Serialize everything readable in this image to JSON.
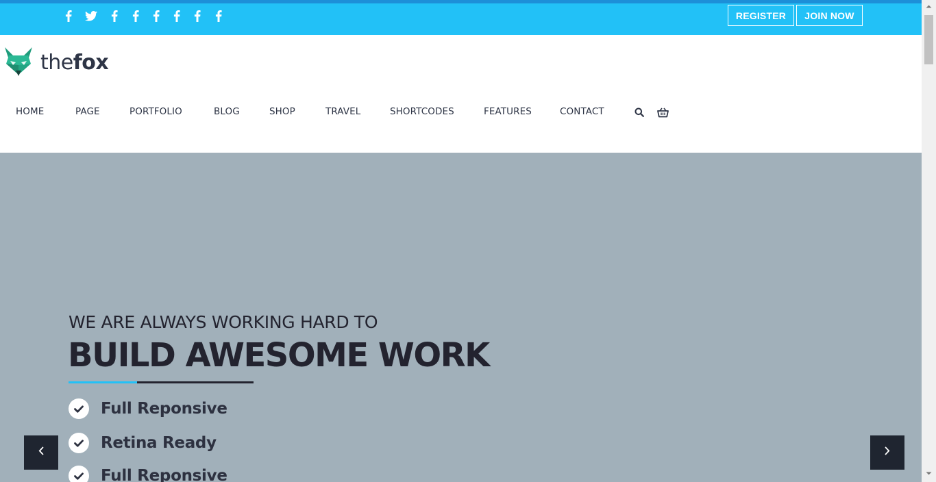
{
  "topbar": {
    "social_icons": [
      "facebook-icon",
      "twitter-icon",
      "facebook-icon",
      "facebook-icon",
      "facebook-icon",
      "facebook-icon",
      "facebook-icon",
      "facebook-icon"
    ],
    "register_label": "REGISTER",
    "join_label": "JOIN NOW",
    "color": "#22c1f7"
  },
  "logo": {
    "prefix": "the",
    "bold": "fox"
  },
  "nav": {
    "items": [
      "HOME",
      "PAGE",
      "PORTFOLIO",
      "BLOG",
      "SHOP",
      "TRAVEL",
      "SHORTCODES",
      "FEATURES",
      "CONTACT"
    ],
    "icons": [
      "search-icon",
      "basket-icon"
    ]
  },
  "hero": {
    "subtitle": "WE ARE ALWAYS WORKING HARD TO",
    "title": "BUILD AWESOME WORK",
    "features": [
      "Full Reponsive",
      "Retina Ready",
      "Full Reponsive"
    ],
    "background": "#a1b0ba",
    "accent": "#22c1f7",
    "prev_icon": "chevron-left-icon",
    "next_icon": "chevron-right-icon"
  }
}
